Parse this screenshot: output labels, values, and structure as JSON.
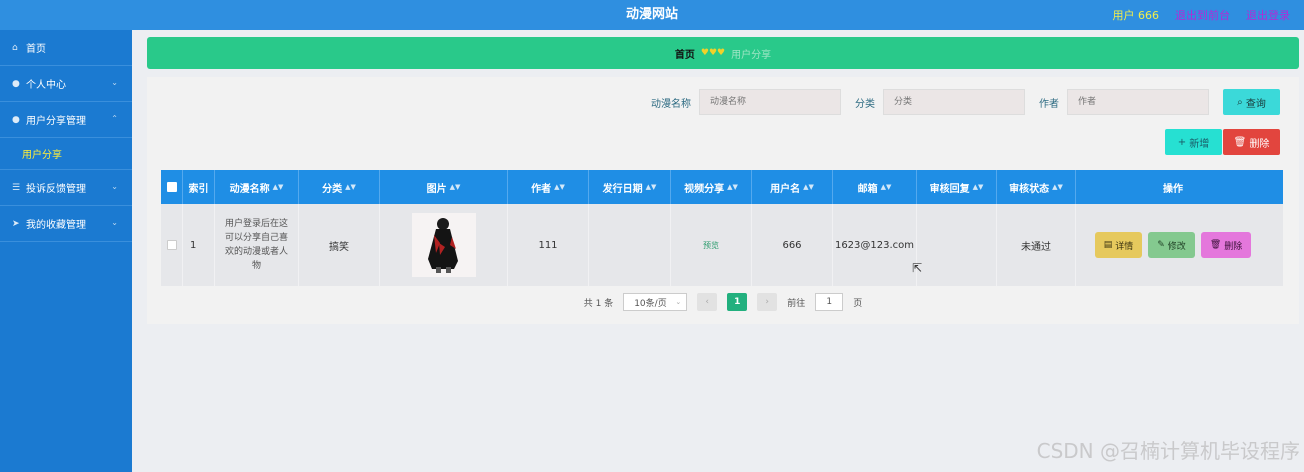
{
  "header": {
    "site_title": "动漫网站",
    "user_label": "用户 666",
    "back_to_admin": "退出到前台",
    "logout": "退出登录"
  },
  "sidebar": {
    "items": [
      {
        "label": "首页",
        "icon": "home-icon"
      },
      {
        "label": "个人中心",
        "icon": "user-icon"
      },
      {
        "label": "用户分享管理",
        "icon": "pin-icon"
      },
      {
        "label": "投诉反馈管理",
        "icon": "list-icon"
      },
      {
        "label": "我的收藏管理",
        "icon": "send-icon"
      }
    ],
    "sub_item": "用户分享"
  },
  "breadcrumb": {
    "home": "首页",
    "separator": "♥♥♥",
    "current": "用户分享"
  },
  "search": {
    "name_label": "动漫名称",
    "name_placeholder": "动漫名称",
    "category_label": "分类",
    "category_placeholder": "分类",
    "author_label": "作者",
    "author_placeholder": "作者",
    "query_button": "查询",
    "add_button": "新增",
    "delete_button": "删除"
  },
  "table": {
    "headers": [
      "索引",
      "动漫名称",
      "分类",
      "图片",
      "作者",
      "发行日期",
      "视频分享",
      "用户名",
      "邮箱",
      "审核回复",
      "审核状态",
      "操作"
    ],
    "rows": [
      {
        "index": "1",
        "name": "用户登录后在这可以分享自己喜欢的动漫或者人物",
        "category": "搞笑",
        "author": "111",
        "release_date": "",
        "video": "预览",
        "username": "666",
        "email": "1623@123.com",
        "review_reply": "",
        "review_status": "未通过",
        "actions": {
          "detail": "详情",
          "edit": "修改",
          "delete": "删除"
        }
      }
    ]
  },
  "pagination": {
    "total": "共 1 条",
    "page_size": "10条/页",
    "current_page": "1",
    "goto_label": "前往",
    "goto_value": "1",
    "page_suffix": "页"
  },
  "watermark": "CSDN @召楠计算机毕设程序",
  "colors": {
    "header_bg": "#2f8fe0",
    "sidebar_bg": "#1b7ad1",
    "breadcrumb_bg": "#29c98a",
    "table_header_bg": "#1f8ee5"
  }
}
